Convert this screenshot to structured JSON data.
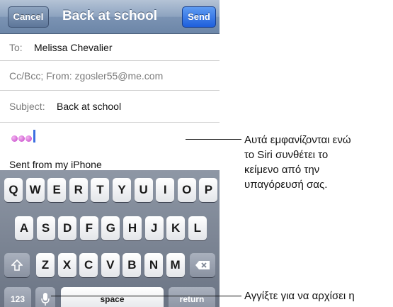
{
  "navbar": {
    "title": "Back at school",
    "cancel_label": "Cancel",
    "send_label": "Send"
  },
  "fields": {
    "to_label": "To:",
    "to_value": "Melissa Chevalier",
    "cc_label": "Cc/Bcc; From: zgosler55@me.com",
    "subject_label": "Subject:",
    "subject_value": "Back at school",
    "signature": "Sent from my iPhone"
  },
  "keyboard": {
    "row1": [
      "Q",
      "W",
      "E",
      "R",
      "T",
      "Y",
      "U",
      "I",
      "O",
      "P"
    ],
    "row2": [
      "A",
      "S",
      "D",
      "F",
      "G",
      "H",
      "J",
      "K",
      "L"
    ],
    "row3": [
      "Z",
      "X",
      "C",
      "V",
      "B",
      "N",
      "M"
    ],
    "numbers_label": "123",
    "space_label": "space",
    "return_label": "return",
    "shift_icon": "shift-icon",
    "delete_icon": "delete-icon",
    "mic_icon": "microphone-icon"
  },
  "callouts": {
    "dictation_note": [
      "Αυτά εμφανίζονται ενώ",
      "το Siri συνθέτει το",
      "κείμενο από την",
      "υπαγόρευσή σας."
    ],
    "mic_note": "Αγγίξτε για να αρχίσει η"
  }
}
